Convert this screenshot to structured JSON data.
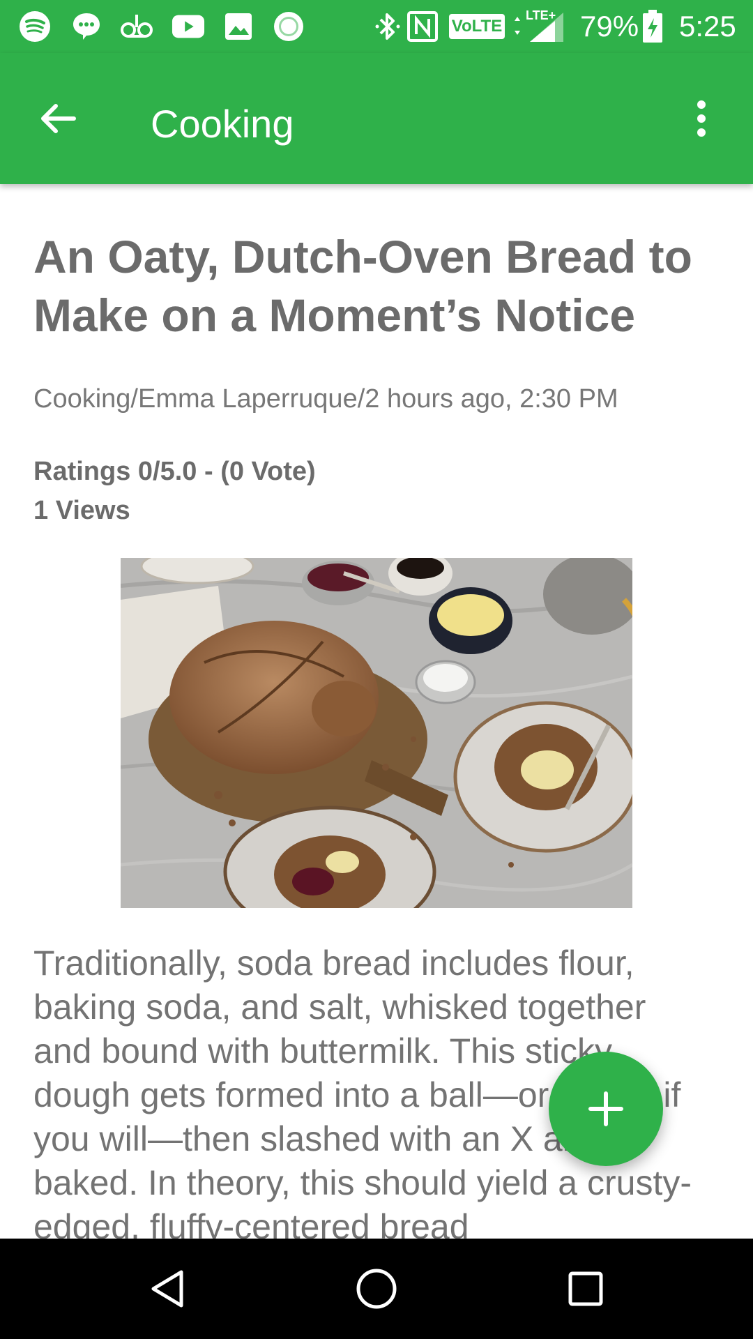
{
  "status_bar": {
    "battery": "79%",
    "time": "5:25",
    "volte": "VoLTE",
    "lte": "LTE+",
    "icons": [
      "spotify-icon",
      "messages-icon",
      "voicemail-icon",
      "youtube-icon",
      "gallery-icon",
      "record-icon",
      "bluetooth-icon",
      "nfc-icon",
      "volte-icon",
      "lte-signal-icon",
      "battery-charging-icon"
    ]
  },
  "app_bar": {
    "title": "Cooking",
    "back_icon": "arrow-back-icon",
    "menu_icon": "more-vert-icon"
  },
  "article": {
    "title": "An Oaty, Dutch-Oven Bread to Make on a Moment’s Notice",
    "byline": "Cooking/Emma Laperruque/2 hours ago, 2:30 PM",
    "ratings": "Ratings 0/5.0 - (0 Vote)",
    "views": "1 Views",
    "body": "Traditionally, soda bread includes flour, baking soda, and salt, whisked together and bound with buttermilk. This sticky dough gets formed into a ball—or boule, if you will—then slashed with an X and baked. In theory, this should yield a crusty-edged, fluffy-centered bread"
  },
  "fab": {
    "icon": "add-icon"
  },
  "nav_bar": {
    "icons": [
      "back-triangle-icon",
      "home-circle-icon",
      "recents-square-icon"
    ]
  },
  "colors": {
    "primary": "#2fb14a",
    "title_text": "#6b6b6b",
    "body_text": "#737373"
  }
}
